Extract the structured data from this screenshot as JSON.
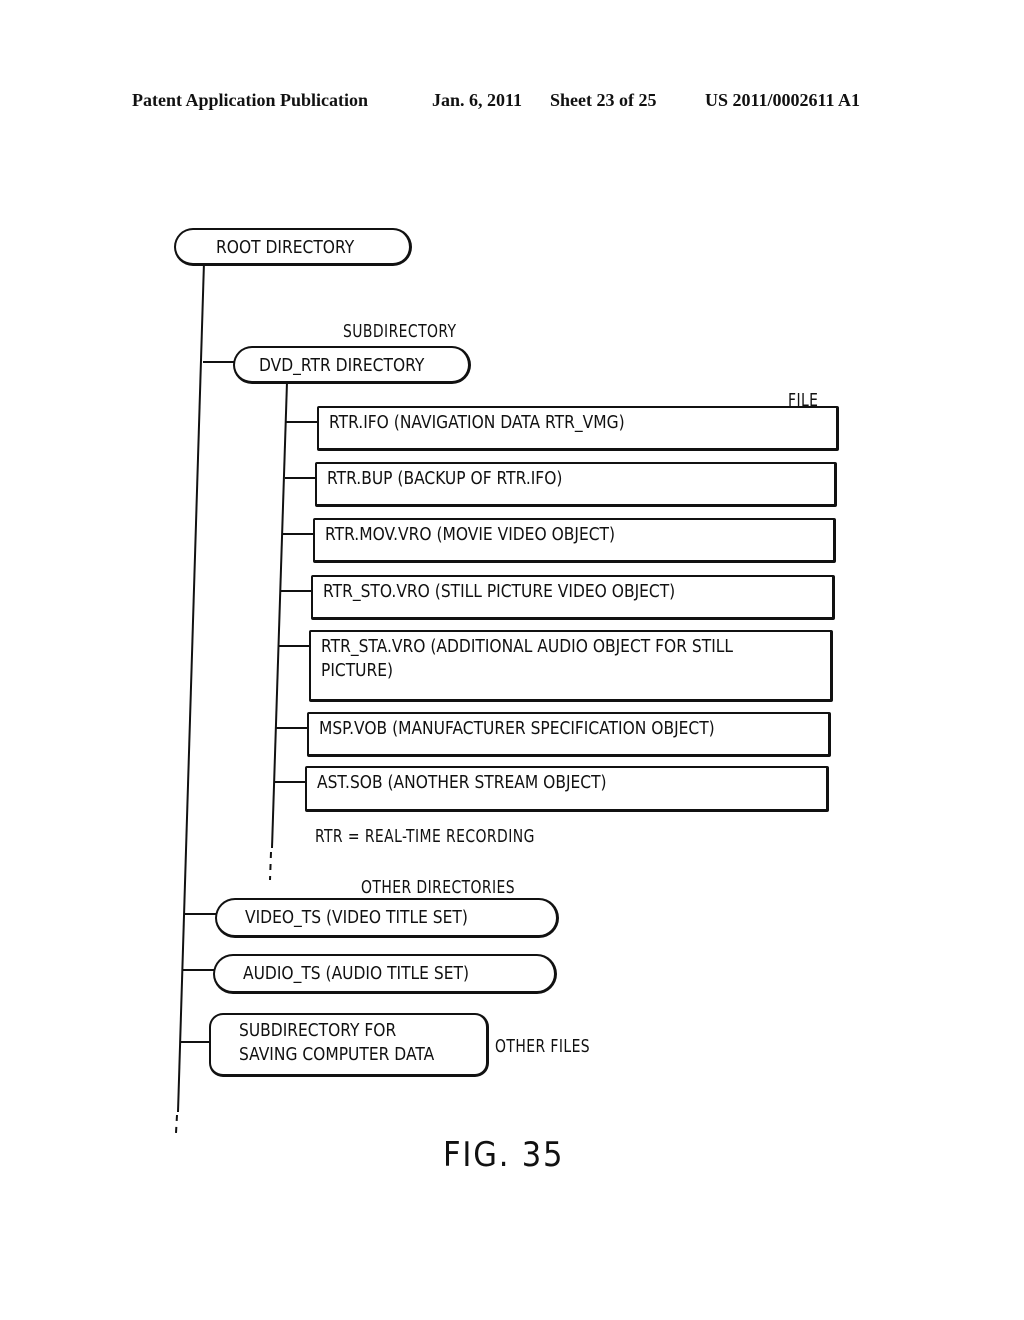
{
  "header": {
    "publication": "Patent Application Publication",
    "date": "Jan. 6, 2011",
    "sheet": "Sheet 23 of 25",
    "number": "US 2011/0002611 A1"
  },
  "diagram": {
    "root": "ROOT DIRECTORY",
    "subdirectory_label": "SUBDIRECTORY",
    "dvd_rtr": "DVD_RTR DIRECTORY",
    "file_label": "FILE",
    "files": [
      {
        "line1": "RTR.IFO (NAVIGATION DATA RTR_VMG)"
      },
      {
        "line1": "RTR.BUP (BACKUP OF RTR.IFO)"
      },
      {
        "line1": "RTR.MOV.VRO (MOVIE VIDEO OBJECT)"
      },
      {
        "line1": "RTR_STO.VRO (STILL PICTURE VIDEO OBJECT)"
      },
      {
        "line1": "RTR_STA.VRO (ADDITIONAL AUDIO OBJECT FOR STILL",
        "line2": "PICTURE)"
      },
      {
        "line1": "MSP.VOB (MANUFACTURER SPECIFICATION OBJECT)"
      },
      {
        "line1": "AST.SOB (ANOTHER STREAM OBJECT)"
      }
    ],
    "rtr_note": "RTR = REAL-TIME RECORDING",
    "other_directories_label": "OTHER DIRECTORIES",
    "video_ts": "VIDEO_TS (VIDEO TITLE SET)",
    "audio_ts": "AUDIO_TS (AUDIO TITLE SET)",
    "computer_data_line1": "SUBDIRECTORY FOR",
    "computer_data_line2": "SAVING COMPUTER DATA",
    "other_files_label": "OTHER FILES"
  },
  "figure_label": "FIG. 35"
}
